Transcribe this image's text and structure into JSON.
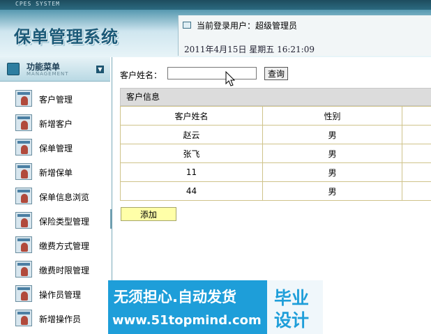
{
  "header": {
    "system_tag": "CPES SYSTEM",
    "title": "保单管理系统",
    "current_user": "当前登录用户：超级管理员",
    "datetime": "2011年4月15日  星期五  16:21:09"
  },
  "sidebar": {
    "title": "功能菜单",
    "subtitle": "MANAGEMENT",
    "items": [
      {
        "label": "客户管理"
      },
      {
        "label": "新增客户"
      },
      {
        "label": "保单管理"
      },
      {
        "label": "新增保单"
      },
      {
        "label": "保单信息浏览"
      },
      {
        "label": "保险类型管理"
      },
      {
        "label": "缴费方式管理"
      },
      {
        "label": "缴费时限管理"
      },
      {
        "label": "操作员管理"
      },
      {
        "label": "新增操作员"
      }
    ]
  },
  "search": {
    "label": "客户姓名：",
    "value": "",
    "button": "查询"
  },
  "table": {
    "title": "客户信息",
    "columns": [
      "客户姓名",
      "性别"
    ],
    "rows": [
      [
        "赵云",
        "男"
      ],
      [
        "张飞",
        "男"
      ],
      [
        "11",
        "男"
      ],
      [
        "44",
        "男"
      ]
    ]
  },
  "add_button": "添加",
  "watermark": {
    "line1": "无须担心.自动发货",
    "line2": "www.51topmind.com",
    "badge1": "毕业",
    "badge2": "设计"
  }
}
